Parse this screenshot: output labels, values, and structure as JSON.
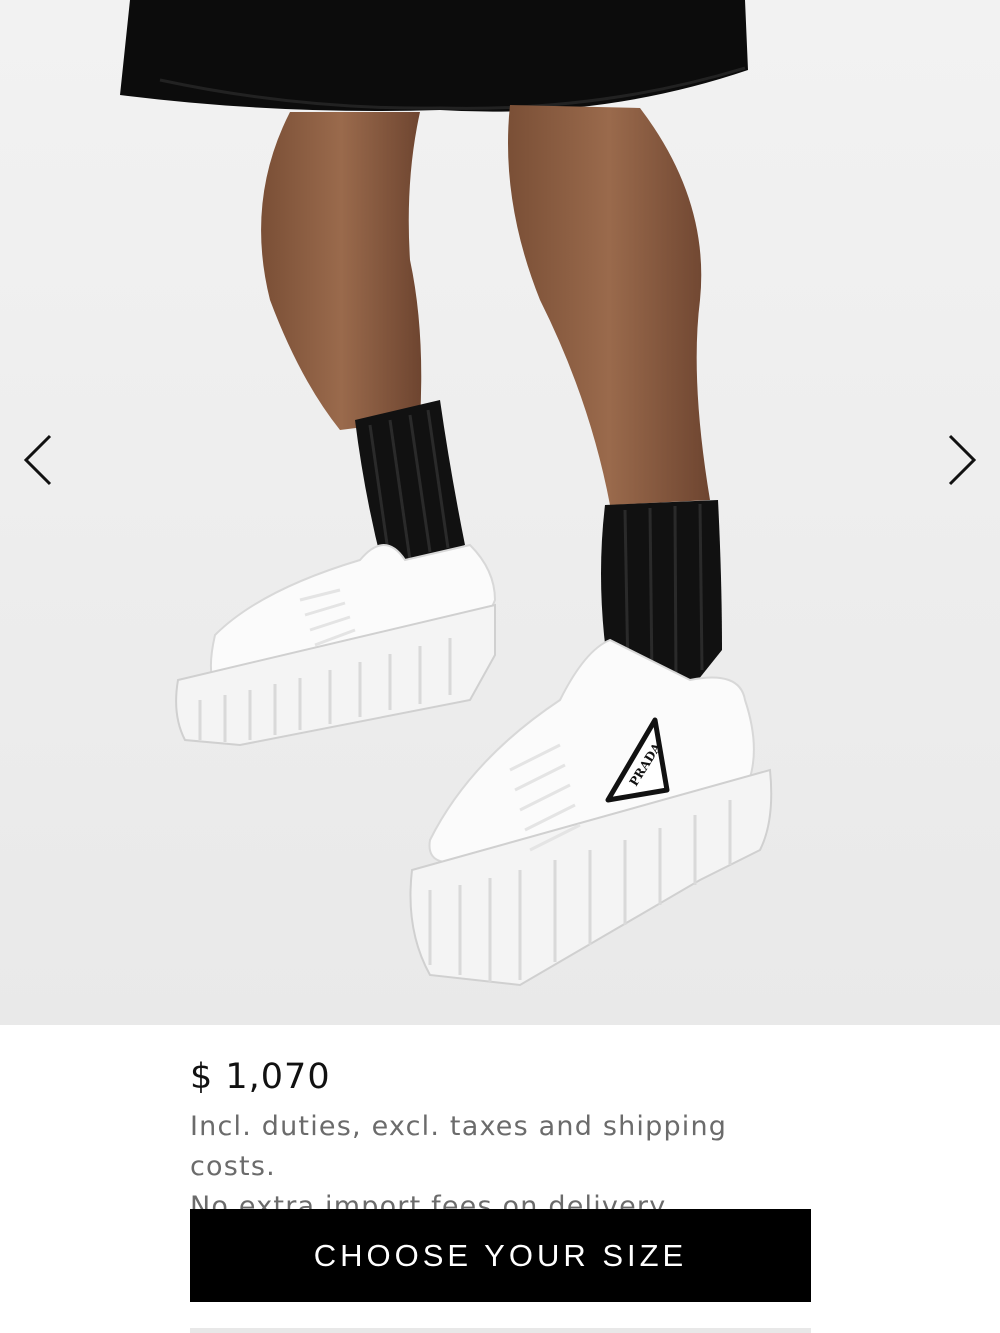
{
  "gallery": {
    "image_alt": "Woman wearing white platform sneakers with black ribbed socks",
    "logo_text": "PRADA",
    "prev_icon": "chevron-left-icon",
    "next_icon": "chevron-right-icon"
  },
  "product": {
    "price": "$ 1,070",
    "note_line1": "Incl. duties, excl. taxes and shipping costs.",
    "note_line2": "No extra import fees on delivery."
  },
  "actions": {
    "choose_size_label": "CHOOSE YOUR SIZE"
  },
  "colors": {
    "button_bg": "#000000",
    "button_text": "#ffffff",
    "price_text": "#111111",
    "note_text": "#6b6b6b",
    "photo_bg": "#efefef"
  }
}
